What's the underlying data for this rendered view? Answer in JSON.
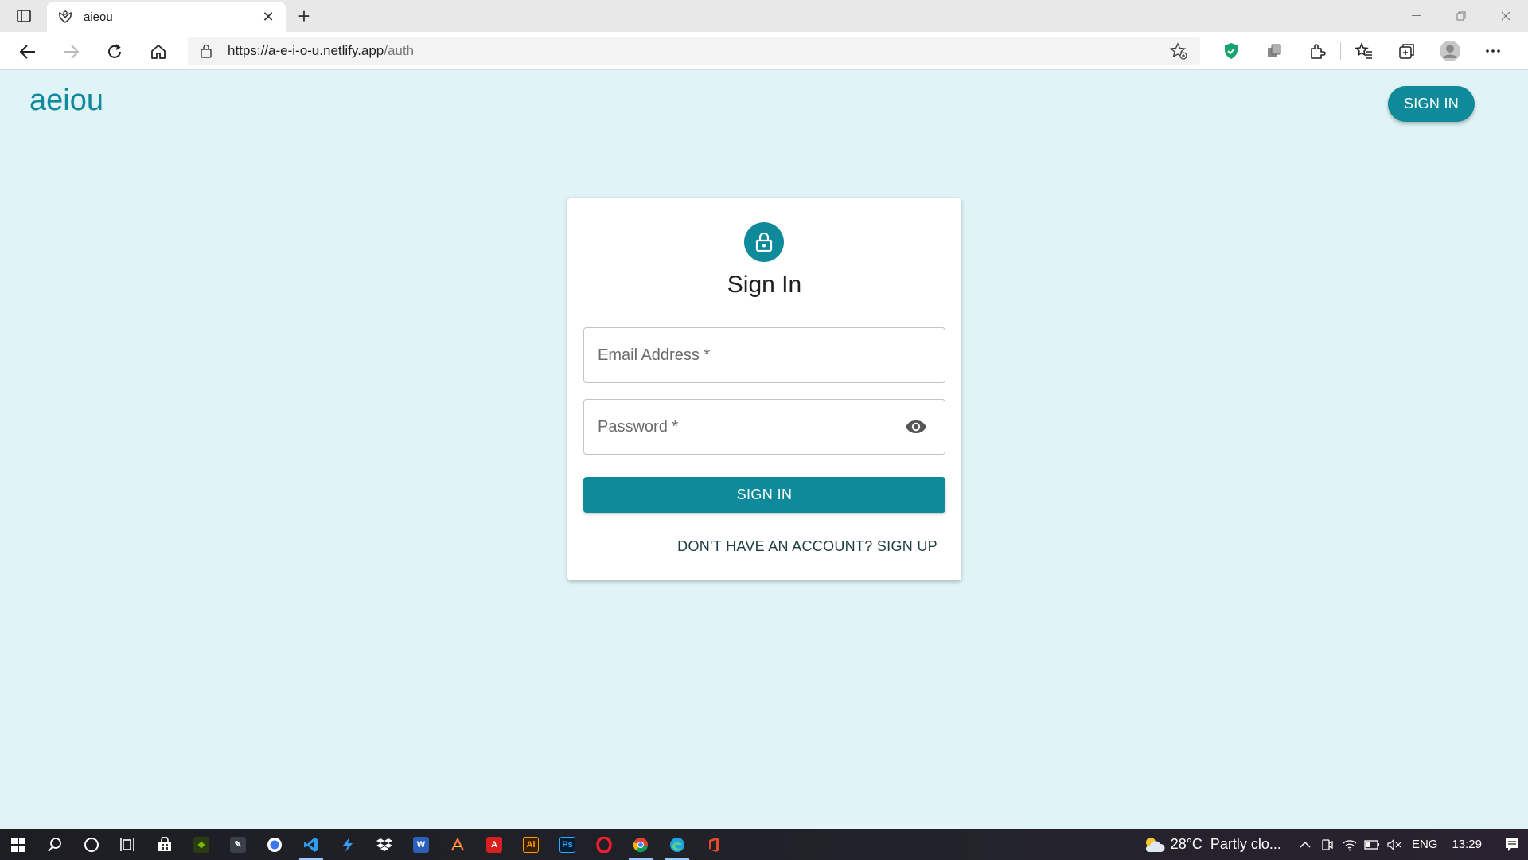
{
  "browser": {
    "tab_title": "aieou",
    "url_host": "https://a-e-i-o-u.netlify.app",
    "url_path": "/auth"
  },
  "header": {
    "brand": "aeiou",
    "signin_label": "SIGN IN"
  },
  "card": {
    "title": "Sign In",
    "email_placeholder": "Email Address *",
    "password_placeholder": "Password *",
    "submit_label": "SIGN IN",
    "signup_link": "DON'T HAVE AN ACCOUNT? SIGN UP"
  },
  "colors": {
    "accent": "#0e8a9b",
    "page_bg": "#e0f4f7"
  },
  "taskbar": {
    "pinned": [
      "nvidia",
      "pen-app",
      "signal",
      "vscode",
      "app-bolt",
      "dropbox",
      "word",
      "git-app",
      "acrobat",
      "illustrator",
      "photoshop",
      "opera",
      "chrome",
      "edge",
      "office"
    ],
    "weather_temp": "28°C",
    "weather_condition": "Partly clo...",
    "language": "ENG",
    "time": "13:29"
  }
}
